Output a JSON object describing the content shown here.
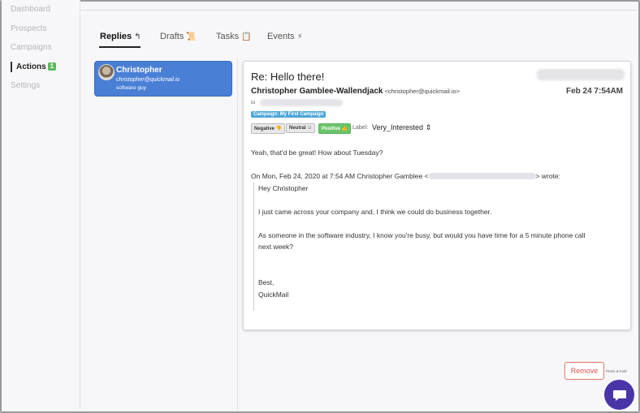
{
  "nav": {
    "items": [
      {
        "label": "Dashboard"
      },
      {
        "label": "Prospects"
      },
      {
        "label": "Campaigns"
      },
      {
        "label": "Actions",
        "badge": "1"
      },
      {
        "label": "Settings"
      }
    ]
  },
  "tabs": [
    {
      "label": "Replies",
      "icon": "reply-arrow-icon"
    },
    {
      "label": "Drafts",
      "icon": "scroll-icon"
    },
    {
      "label": "Tasks",
      "icon": "clipboard-icon"
    },
    {
      "label": "Events",
      "icon": "lightning-icon"
    }
  ],
  "conversation": {
    "name": "Christopher",
    "email": "christopher@quickmail.io",
    "role": "software guy"
  },
  "message": {
    "subject": "Re: Hello there!",
    "sender_name": "Christopher Gamblee-Wallendjack",
    "sender_email": "<christopher@quickmail.io>",
    "date": "Feb 24 7:54AM",
    "to_label": "to",
    "campaign_tag": "Campaign: My First Campaign",
    "sentiment": {
      "negative": "Negative",
      "neutral": "Neutral",
      "positive": "Positive"
    },
    "label_text": "Label:",
    "label_value": "Very_Interested",
    "reply": "Yeah, that'd be great! How about Tuesday?",
    "quote_header_start": "On Mon, Feb 24, 2020 at 7:54 AM Christopher Gamblee <",
    "quote_header_end": "> wrote:",
    "quote_lines": [
      "Hey Christopher",
      "I just came across your company and, I think we could do business together.",
      "As someone in the software industry, I know you're busy, but would you have time for a 5 minute phone call",
      "next week?",
      "Best,",
      "QuickMail"
    ]
  },
  "actions": {
    "remove_label": "Remove",
    "hint": "Press & hold"
  },
  "colors": {
    "selected_card": "#4a7fd6",
    "campaign_tag": "#4ea6d8",
    "positive": "#6cc46a",
    "badge": "#5cb85c",
    "remove": "#d9534f",
    "chat": "#4b34a8"
  }
}
